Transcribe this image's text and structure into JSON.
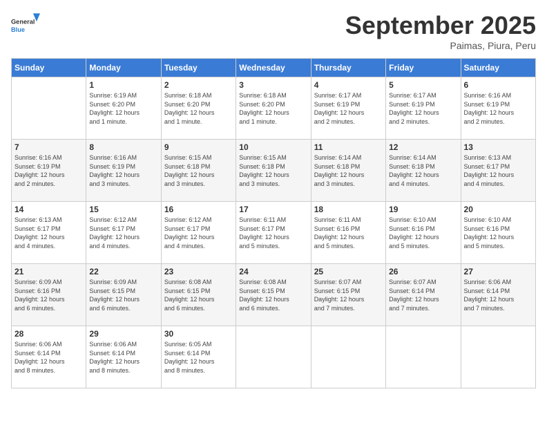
{
  "header": {
    "logo_general": "General",
    "logo_blue": "Blue",
    "month_title": "September 2025",
    "subtitle": "Paimas, Piura, Peru"
  },
  "days_of_week": [
    "Sunday",
    "Monday",
    "Tuesday",
    "Wednesday",
    "Thursday",
    "Friday",
    "Saturday"
  ],
  "weeks": [
    [
      {
        "day": "",
        "info": ""
      },
      {
        "day": "1",
        "info": "Sunrise: 6:19 AM\nSunset: 6:20 PM\nDaylight: 12 hours\nand 1 minute."
      },
      {
        "day": "2",
        "info": "Sunrise: 6:18 AM\nSunset: 6:20 PM\nDaylight: 12 hours\nand 1 minute."
      },
      {
        "day": "3",
        "info": "Sunrise: 6:18 AM\nSunset: 6:20 PM\nDaylight: 12 hours\nand 1 minute."
      },
      {
        "day": "4",
        "info": "Sunrise: 6:17 AM\nSunset: 6:19 PM\nDaylight: 12 hours\nand 2 minutes."
      },
      {
        "day": "5",
        "info": "Sunrise: 6:17 AM\nSunset: 6:19 PM\nDaylight: 12 hours\nand 2 minutes."
      },
      {
        "day": "6",
        "info": "Sunrise: 6:16 AM\nSunset: 6:19 PM\nDaylight: 12 hours\nand 2 minutes."
      }
    ],
    [
      {
        "day": "7",
        "info": "Sunrise: 6:16 AM\nSunset: 6:19 PM\nDaylight: 12 hours\nand 2 minutes."
      },
      {
        "day": "8",
        "info": "Sunrise: 6:16 AM\nSunset: 6:19 PM\nDaylight: 12 hours\nand 3 minutes."
      },
      {
        "day": "9",
        "info": "Sunrise: 6:15 AM\nSunset: 6:18 PM\nDaylight: 12 hours\nand 3 minutes."
      },
      {
        "day": "10",
        "info": "Sunrise: 6:15 AM\nSunset: 6:18 PM\nDaylight: 12 hours\nand 3 minutes."
      },
      {
        "day": "11",
        "info": "Sunrise: 6:14 AM\nSunset: 6:18 PM\nDaylight: 12 hours\nand 3 minutes."
      },
      {
        "day": "12",
        "info": "Sunrise: 6:14 AM\nSunset: 6:18 PM\nDaylight: 12 hours\nand 4 minutes."
      },
      {
        "day": "13",
        "info": "Sunrise: 6:13 AM\nSunset: 6:17 PM\nDaylight: 12 hours\nand 4 minutes."
      }
    ],
    [
      {
        "day": "14",
        "info": "Sunrise: 6:13 AM\nSunset: 6:17 PM\nDaylight: 12 hours\nand 4 minutes."
      },
      {
        "day": "15",
        "info": "Sunrise: 6:12 AM\nSunset: 6:17 PM\nDaylight: 12 hours\nand 4 minutes."
      },
      {
        "day": "16",
        "info": "Sunrise: 6:12 AM\nSunset: 6:17 PM\nDaylight: 12 hours\nand 4 minutes."
      },
      {
        "day": "17",
        "info": "Sunrise: 6:11 AM\nSunset: 6:17 PM\nDaylight: 12 hours\nand 5 minutes."
      },
      {
        "day": "18",
        "info": "Sunrise: 6:11 AM\nSunset: 6:16 PM\nDaylight: 12 hours\nand 5 minutes."
      },
      {
        "day": "19",
        "info": "Sunrise: 6:10 AM\nSunset: 6:16 PM\nDaylight: 12 hours\nand 5 minutes."
      },
      {
        "day": "20",
        "info": "Sunrise: 6:10 AM\nSunset: 6:16 PM\nDaylight: 12 hours\nand 5 minutes."
      }
    ],
    [
      {
        "day": "21",
        "info": "Sunrise: 6:09 AM\nSunset: 6:16 PM\nDaylight: 12 hours\nand 6 minutes."
      },
      {
        "day": "22",
        "info": "Sunrise: 6:09 AM\nSunset: 6:15 PM\nDaylight: 12 hours\nand 6 minutes."
      },
      {
        "day": "23",
        "info": "Sunrise: 6:08 AM\nSunset: 6:15 PM\nDaylight: 12 hours\nand 6 minutes."
      },
      {
        "day": "24",
        "info": "Sunrise: 6:08 AM\nSunset: 6:15 PM\nDaylight: 12 hours\nand 6 minutes."
      },
      {
        "day": "25",
        "info": "Sunrise: 6:07 AM\nSunset: 6:15 PM\nDaylight: 12 hours\nand 7 minutes."
      },
      {
        "day": "26",
        "info": "Sunrise: 6:07 AM\nSunset: 6:14 PM\nDaylight: 12 hours\nand 7 minutes."
      },
      {
        "day": "27",
        "info": "Sunrise: 6:06 AM\nSunset: 6:14 PM\nDaylight: 12 hours\nand 7 minutes."
      }
    ],
    [
      {
        "day": "28",
        "info": "Sunrise: 6:06 AM\nSunset: 6:14 PM\nDaylight: 12 hours\nand 8 minutes."
      },
      {
        "day": "29",
        "info": "Sunrise: 6:06 AM\nSunset: 6:14 PM\nDaylight: 12 hours\nand 8 minutes."
      },
      {
        "day": "30",
        "info": "Sunrise: 6:05 AM\nSunset: 6:14 PM\nDaylight: 12 hours\nand 8 minutes."
      },
      {
        "day": "",
        "info": ""
      },
      {
        "day": "",
        "info": ""
      },
      {
        "day": "",
        "info": ""
      },
      {
        "day": "",
        "info": ""
      }
    ]
  ]
}
